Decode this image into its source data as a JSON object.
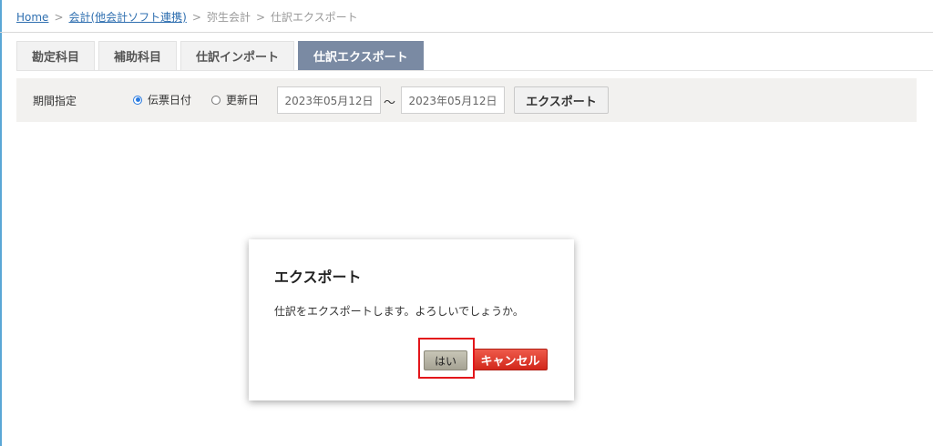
{
  "breadcrumb": {
    "home": "Home",
    "integration": "会計(他会計ソフト連携)",
    "yayoi": "弥生会計",
    "current": "仕訳エクスポート",
    "separator": ">"
  },
  "tabs": [
    {
      "label": "勘定科目",
      "active": false
    },
    {
      "label": "補助科目",
      "active": false
    },
    {
      "label": "仕訳インポート",
      "active": false
    },
    {
      "label": "仕訳エクスポート",
      "active": true
    }
  ],
  "filter": {
    "period_label": "期間指定",
    "radio_options": [
      {
        "label": "伝票日付",
        "checked": true
      },
      {
        "label": "更新日",
        "checked": false
      }
    ],
    "date_from": "2023年05月12日",
    "range_sep": "〜",
    "date_to": "2023年05月12日",
    "export_button": "エクスポート"
  },
  "dialog": {
    "title": "エクスポート",
    "message": "仕訳をエクスポートします。よろしいでしょうか。",
    "yes_button": "はい",
    "cancel_button": "キャンセル"
  },
  "colors": {
    "active_tab": "#7a8aa3",
    "cancel_button": "#d2271b",
    "yes_button": "#a6a394",
    "highlight": "#e3161b",
    "link": "#2f6fb0"
  }
}
